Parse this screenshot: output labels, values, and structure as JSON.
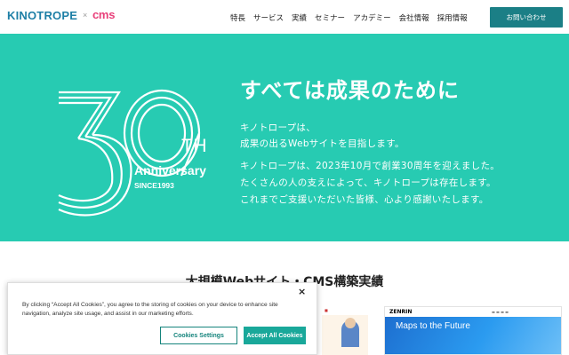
{
  "header": {
    "logo": "KINOTROPE",
    "logo_separator": "×",
    "cms_logo": "cms",
    "nav": [
      "特長",
      "サービス",
      "実績",
      "セミナー",
      "アカデミー",
      "会社情報",
      "採用情報"
    ],
    "contact_button": "お問い合わせ"
  },
  "hero": {
    "anniversary": {
      "number": "30",
      "suffix": "TH",
      "label": "Anniversary",
      "since": "SINCE1993"
    },
    "title": "すべては成果のために",
    "lines": [
      "キノトロープは、",
      "成果の出るWebサイトを目指します。",
      "キノトロープは、2023年10月で創業30周年を迎えました。",
      "たくさんの人の支えによって、キノトロープは存在します。",
      "これまでご支援いただいた皆様、心より感謝いたします。"
    ],
    "colors": {
      "background": "#27cbb2",
      "text": "#ffffff"
    }
  },
  "section": {
    "title": "大規模Webサイト・CMS構築実績",
    "zenrin_thumb": {
      "brand": "ZENRIN",
      "headline": "Maps to the Future"
    }
  },
  "cookie_banner": {
    "text": "By clicking “Accept All Cookies”, you agree to the storing of cookies on your device to enhance site navigation, analyze site usage, and assist in our marketing efforts.",
    "close_label": "×",
    "settings_label": "Cookies Settings",
    "accept_label": "Accept All Cookies"
  }
}
